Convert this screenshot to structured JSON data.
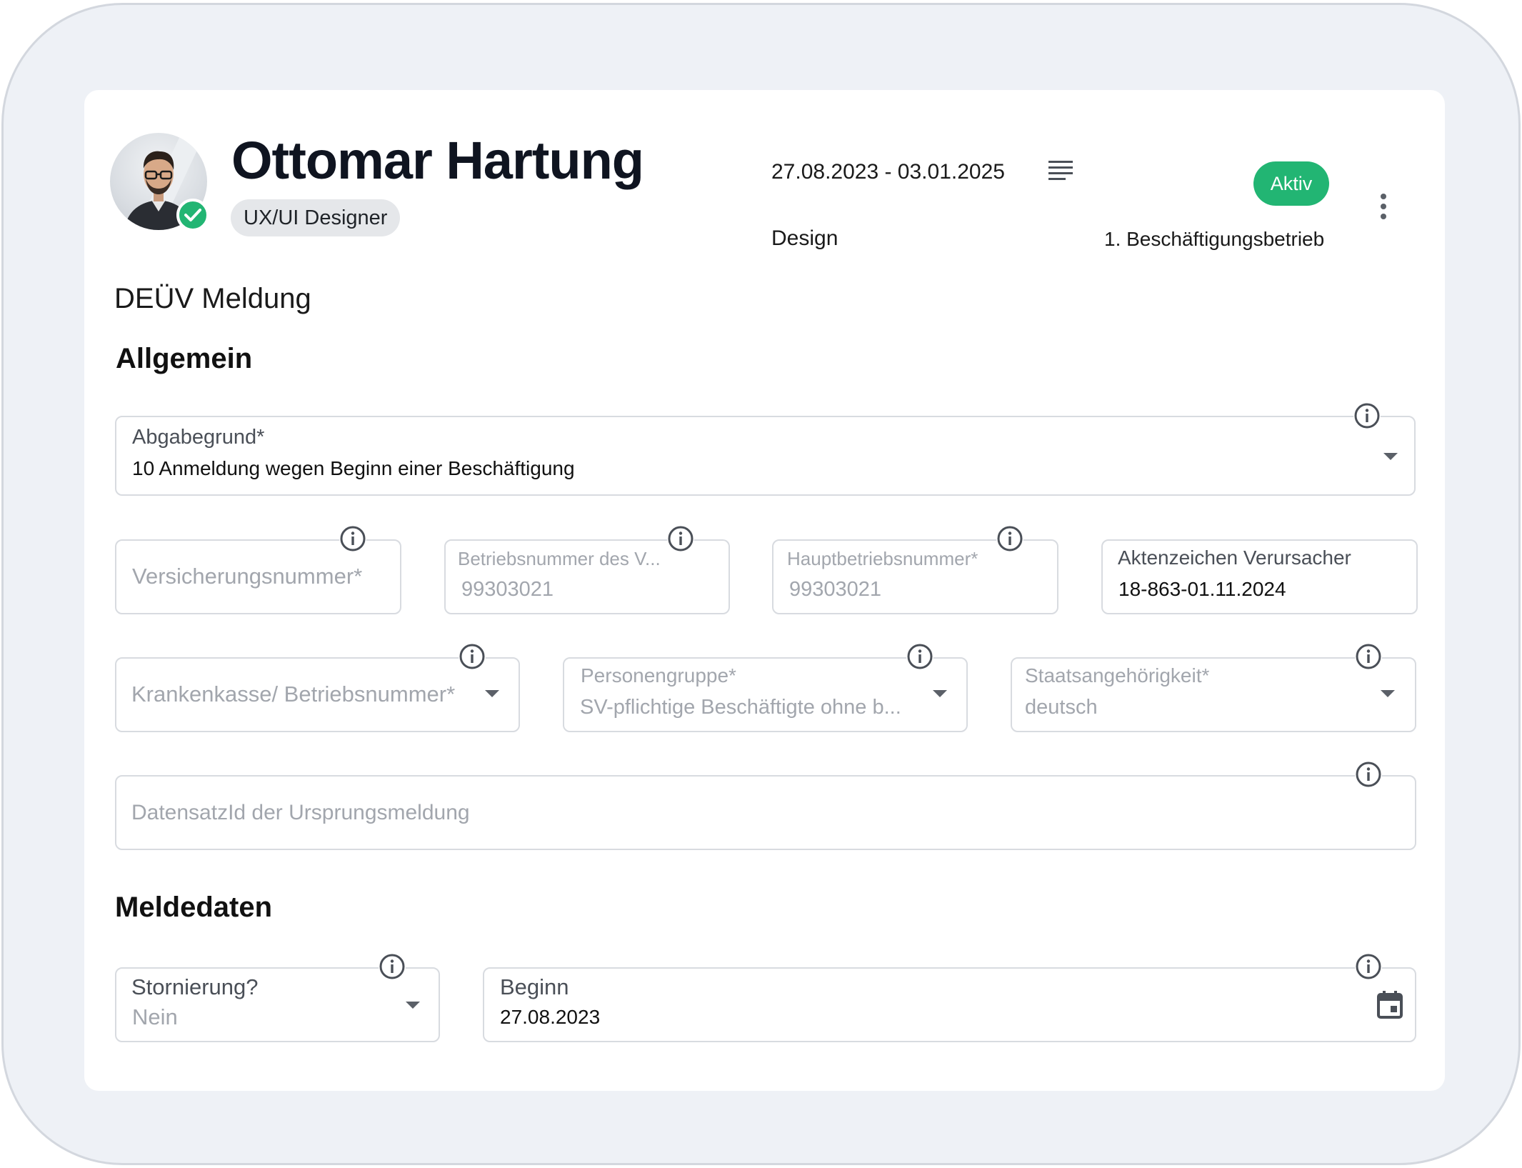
{
  "employee": {
    "name": "Ottomar Hartung",
    "role": "UX/UI Designer",
    "period": "27.08.2023 - 03.01.2025",
    "status": "Aktiv",
    "department": "Design",
    "employer": "1. Beschäftigungsbetrieb"
  },
  "page": {
    "title": "DEÜV Meldung"
  },
  "sections": {
    "general": "Allgemein",
    "report_data": "Meldedaten"
  },
  "fields": {
    "abgabegrund": {
      "label": "Abgabegrund*",
      "value": "10 Anmeldung wegen Beginn einer Beschäftigung"
    },
    "versicherungsnummer": {
      "placeholder": "Versicherungsnummer*"
    },
    "betriebsnummer": {
      "label": "Betriebsnummer des V...",
      "value": "99303021"
    },
    "hauptbetriebsnummer": {
      "label": "Hauptbetriebsnummer*",
      "value": "99303021"
    },
    "aktenzeichen": {
      "label": "Aktenzeichen Verursacher",
      "value": "18-863-01.11.2024"
    },
    "krankenkasse": {
      "placeholder": "Krankenkasse/ Betriebsnummer*"
    },
    "personengruppe": {
      "label": "Personengruppe*",
      "value": "SV-pflichtige Beschäftigte ohne b..."
    },
    "staatsangehoerigkeit": {
      "label": "Staatsangehörigkeit*",
      "value": "deutsch"
    },
    "datensatzid": {
      "placeholder": "DatensatzId der Ursprungsmeldung"
    },
    "stornierung": {
      "label": "Stornierung?",
      "value": "Nein"
    },
    "beginn": {
      "label": "Beginn",
      "value": "27.08.2023"
    }
  },
  "icons": {
    "info": "info-icon",
    "dropdown": "chevron-down-icon",
    "calendar": "calendar-icon",
    "list": "list-icon",
    "more": "more-vertical-icon",
    "verified": "check-icon"
  },
  "colors": {
    "status_green": "#22b573",
    "border": "#d8dbe0",
    "muted_text": "#a2a6ad",
    "background": "#eef1f6"
  }
}
